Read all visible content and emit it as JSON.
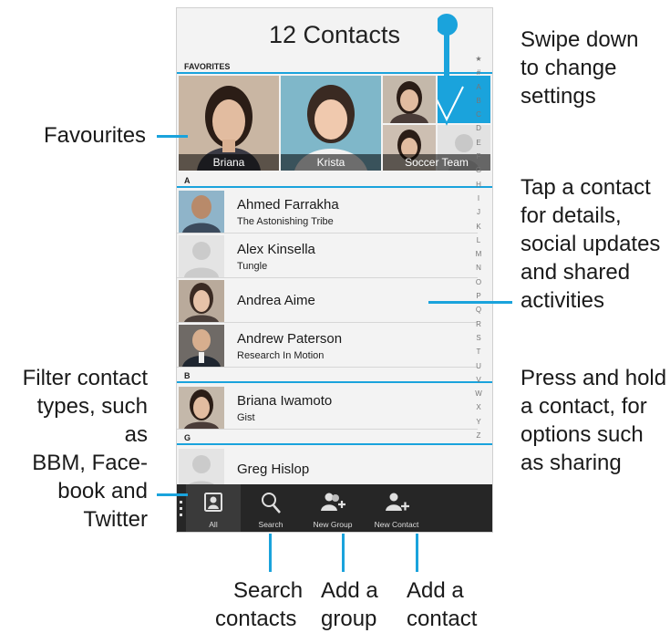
{
  "header": {
    "title": "12 Contacts"
  },
  "favorites": {
    "label": "FAVORITES",
    "items": [
      {
        "name": "Briana"
      },
      {
        "name": "Krista"
      },
      {
        "name": "Soccer Team"
      }
    ]
  },
  "alphabet": [
    "★",
    "#",
    "A",
    "B",
    "C",
    "D",
    "E",
    "F",
    "G",
    "H",
    "I",
    "J",
    "K",
    "L",
    "M",
    "N",
    "O",
    "P",
    "Q",
    "R",
    "S",
    "T",
    "U",
    "V",
    "W",
    "X",
    "Y",
    "Z"
  ],
  "sections": {
    "a": "A",
    "b": "B",
    "g": "G"
  },
  "contacts": [
    {
      "name": "Ahmed Farrakha",
      "detail": "The Astonishing Tribe"
    },
    {
      "name": "Alex Kinsella",
      "detail": "Tungle"
    },
    {
      "name": "Andrea Aime",
      "detail": ""
    },
    {
      "name": "Andrew Paterson",
      "detail": "Research In Motion"
    },
    {
      "name": "Briana Iwamoto",
      "detail": "Gist"
    },
    {
      "name": "Greg Hislop",
      "detail": ""
    }
  ],
  "toolbar": {
    "all": "All",
    "search": "Search",
    "new_group": "New Group",
    "new_contact": "New Contact"
  },
  "annotations": {
    "swipe": [
      "Swipe down",
      "to change",
      "settings"
    ],
    "favourites": [
      "Favourites"
    ],
    "tap": [
      "Tap a contact",
      "for details,",
      "social updates",
      "and shared",
      "activities"
    ],
    "press": [
      "Press and hold",
      "a contact, for",
      "options such",
      "as sharing"
    ],
    "filter": [
      "Filter contact",
      "types, such as",
      "BBM, Face-",
      "book and",
      "Twitter"
    ],
    "search": [
      "Search",
      "contacts"
    ],
    "group": [
      "Add a",
      "group"
    ],
    "contact": [
      "Add a",
      "contact"
    ]
  },
  "colors": {
    "accent": "#1aa3dc",
    "toolbar": "#262626",
    "background": "#f3f3f3"
  }
}
